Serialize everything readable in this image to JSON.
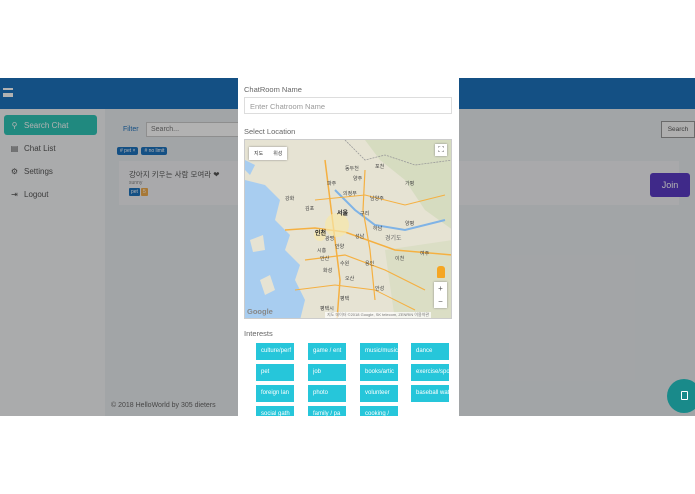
{
  "app": {
    "sidebar": {
      "items": [
        {
          "label": "Search Chat",
          "icon": "search-icon",
          "active": true
        },
        {
          "label": "Chat List",
          "icon": "chat-icon",
          "active": false
        },
        {
          "label": "Settings",
          "icon": "gear-icon",
          "active": false
        },
        {
          "label": "Logout",
          "icon": "logout-icon",
          "active": false
        }
      ]
    },
    "search": {
      "filter_label": "Filter",
      "placeholder": "Search...",
      "button_label": "Search"
    },
    "tags": [
      "# pet ×",
      "# no limit"
    ],
    "room_card": {
      "title": "강아지 키우는 사람 모여라 ❤",
      "subtitle": "sunny",
      "badges": [
        "pet",
        "5"
      ],
      "join_label": "Join"
    },
    "footer": "© 2018 HelloWorld by 305 dieters"
  },
  "modal": {
    "chatroom_name_label": "ChatRoom Name",
    "chatroom_name_placeholder": "Enter Chatroom Name",
    "location_label": "Select Location",
    "map": {
      "type_buttons": [
        "지도",
        "위성"
      ],
      "google": "Google",
      "attribution": "지도 데이터 ©2018 Google, SK telecom, ZENRIN  이용약관",
      "place_labels": [
        "파주",
        "동두천",
        "포천",
        "의정부",
        "서울",
        "인천",
        "구리",
        "광명",
        "안양",
        "성남",
        "하남",
        "수원",
        "화성",
        "용인",
        "평택",
        "오산",
        "가평",
        "양주",
        "남양주",
        "경기도",
        "양평",
        "이천",
        "여주",
        "안성",
        "평택시",
        "강화",
        "김포",
        "시흥",
        "안산"
      ]
    },
    "interests_label": "Interests",
    "interests": [
      [
        "culture/perf",
        "game / ent",
        "music/music",
        "dance"
      ],
      [
        "pet",
        "job",
        "books/artic",
        "exercise/sports"
      ],
      [
        "foreign lan",
        "photo",
        "volunteer",
        "baseball watching"
      ],
      [
        "social gath",
        "family / pa",
        "cooking /"
      ]
    ]
  },
  "colors": {
    "topbar": "#1e73be",
    "accent": "#2ec4b6",
    "join": "#5b3cc4",
    "interest": "#26c6da",
    "fab": "#198a8a"
  }
}
